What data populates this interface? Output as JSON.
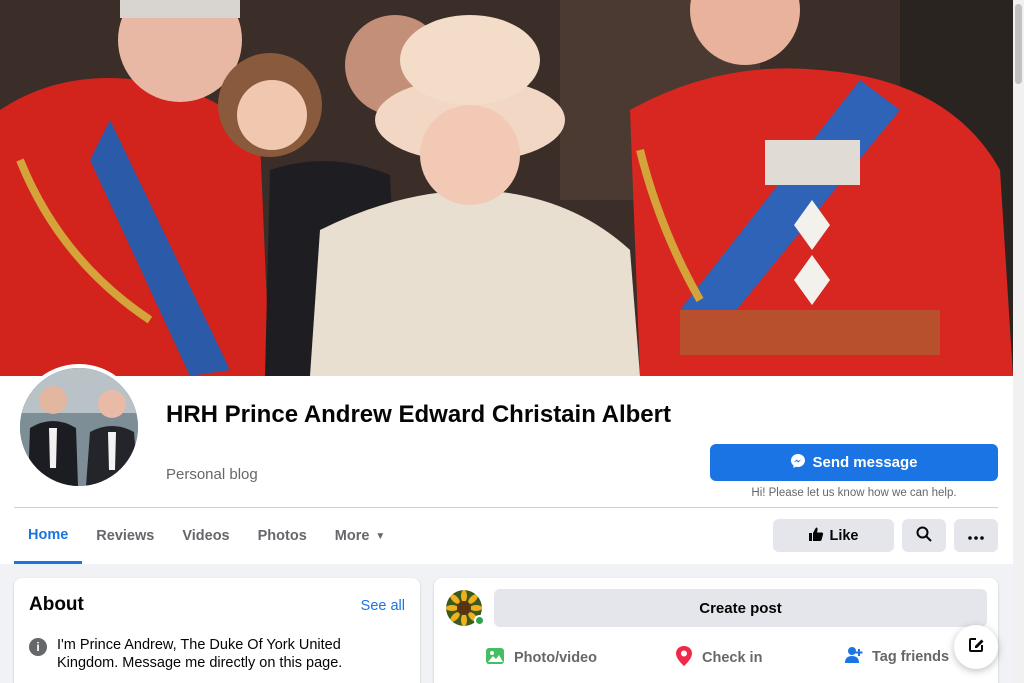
{
  "page": {
    "name": "HRH Prince Andrew Edward Christain Albert",
    "category": "Personal blog"
  },
  "cta": {
    "send_label": "Send message",
    "hint": "Hi! Please let us know how we can help."
  },
  "tabs": [
    {
      "label": "Home",
      "active": true
    },
    {
      "label": "Reviews"
    },
    {
      "label": "Videos"
    },
    {
      "label": "Photos"
    },
    {
      "label": "More"
    }
  ],
  "actions": {
    "like_label": "Like"
  },
  "about": {
    "title": "About",
    "see_all": "See all",
    "text": "I'm Prince Andrew, The Duke Of York United Kingdom. Message me directly on this page."
  },
  "composer": {
    "create_post": "Create post",
    "photo_video": "Photo/video",
    "check_in": "Check in",
    "tag_friends": "Tag friends"
  },
  "colors": {
    "accent": "#1b74e4",
    "online": "#31a24c",
    "photo_green": "#45bd62",
    "checkin_red": "#f02849"
  },
  "icons": [
    "messenger-icon",
    "caret-down-icon",
    "thumbs-up-icon",
    "search-icon",
    "more-dots-icon",
    "info-icon",
    "photo-icon",
    "location-pin-icon",
    "tag-people-icon",
    "compose-icon"
  ]
}
